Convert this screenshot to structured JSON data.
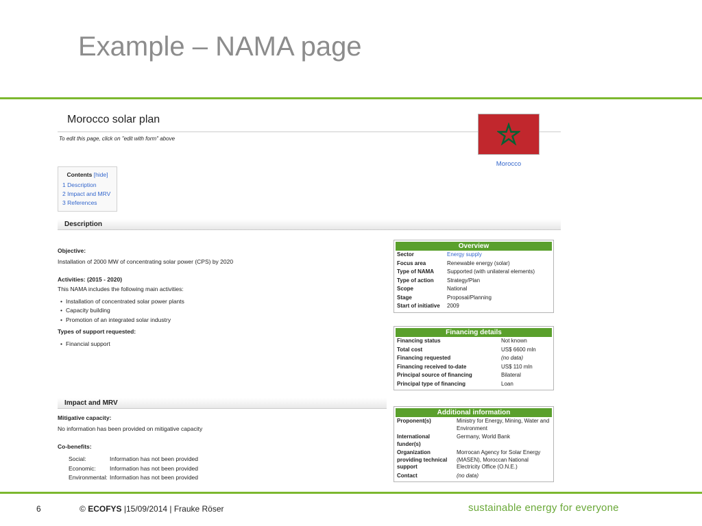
{
  "slide": {
    "title": "Example – NAMA page",
    "accent_color": "#7cb82f"
  },
  "page": {
    "heading": "Morocco solar plan",
    "edit_note": "To edit this page, click on \"edit with form\" above",
    "flag_caption": "Morocco",
    "flag_icon": "morocco-flag",
    "toc": {
      "title": "Contents",
      "hide": "[hide]",
      "items": [
        "1 Description",
        "2 Impact and MRV",
        "3 References"
      ]
    },
    "description": {
      "heading": "Description",
      "objective_label": "Objective:",
      "objective_text": "Installation of 2000 MW of concentrating solar power (CPS) by 2020",
      "activities_label": "Activities: (2015 - 2020)",
      "activities_intro": "This NAMA includes the following main activities:",
      "activities": [
        "Installation of concentrated solar power plants",
        "Capacity building",
        "Promotion of an integrated solar industry"
      ],
      "support_label": "Types of support requested:",
      "support_items": [
        "Financial support"
      ]
    },
    "impact": {
      "heading": "Impact and MRV",
      "mitigative_label": "Mitigative capacity:",
      "mitigative_text": "No information has been provided on mitigative capacity",
      "cobenefits_label": "Co-benefits:",
      "cobenefits": [
        {
          "k": "Social:",
          "v": "Information has not been provided"
        },
        {
          "k": "Economic:",
          "v": "Information has not been provided"
        },
        {
          "k": "Environmental:",
          "v": "Information has not been provided"
        }
      ]
    },
    "overview": {
      "title": "Overview",
      "rows": [
        {
          "k": "Sector",
          "v": "Energy supply"
        },
        {
          "k": "Focus area",
          "v": "Renewable energy (solar)"
        },
        {
          "k": "Type of NAMA",
          "v": "Supported (with unilateral elements)"
        },
        {
          "k": "Type of action",
          "v": "Strategy/Plan"
        },
        {
          "k": "Scope",
          "v": "National"
        },
        {
          "k": "Stage",
          "v": "Proposal/Planning"
        },
        {
          "k": "Start of initiative",
          "v": "2009"
        }
      ]
    },
    "financing": {
      "title": "Financing details",
      "rows": [
        {
          "k": "Financing status",
          "v": "Not known"
        },
        {
          "k": "Total cost",
          "v": "US$ 6600 mln"
        },
        {
          "k": "Financing requested",
          "v": "(no data)"
        },
        {
          "k": "Financing received to-date",
          "v": "US$ 110 mln"
        },
        {
          "k": "Principal source of financing",
          "v": "Bilateral"
        },
        {
          "k": "Principal type of financing",
          "v": "Loan"
        }
      ]
    },
    "additional": {
      "title": "Additional information",
      "rows": [
        {
          "k": "Proponent(s)",
          "v": "Ministry for Energy, Mining, Water and Environment"
        },
        {
          "k": "International funder(s)",
          "v": "Germany, World Bank"
        },
        {
          "k": "Organization providing technical support",
          "v": "Morrocan Agency for Solar Energy (MASEN), Moroccan National Electricity Office (O.N.E.)"
        },
        {
          "k": "Contact",
          "v": "(no data)"
        }
      ]
    }
  },
  "footer": {
    "page_number": "6",
    "copyright": "©",
    "brand": "ECOFYS",
    "meta": "|15/09/2014 | Frauke Röser",
    "tagline": "sustainable energy for everyone"
  }
}
